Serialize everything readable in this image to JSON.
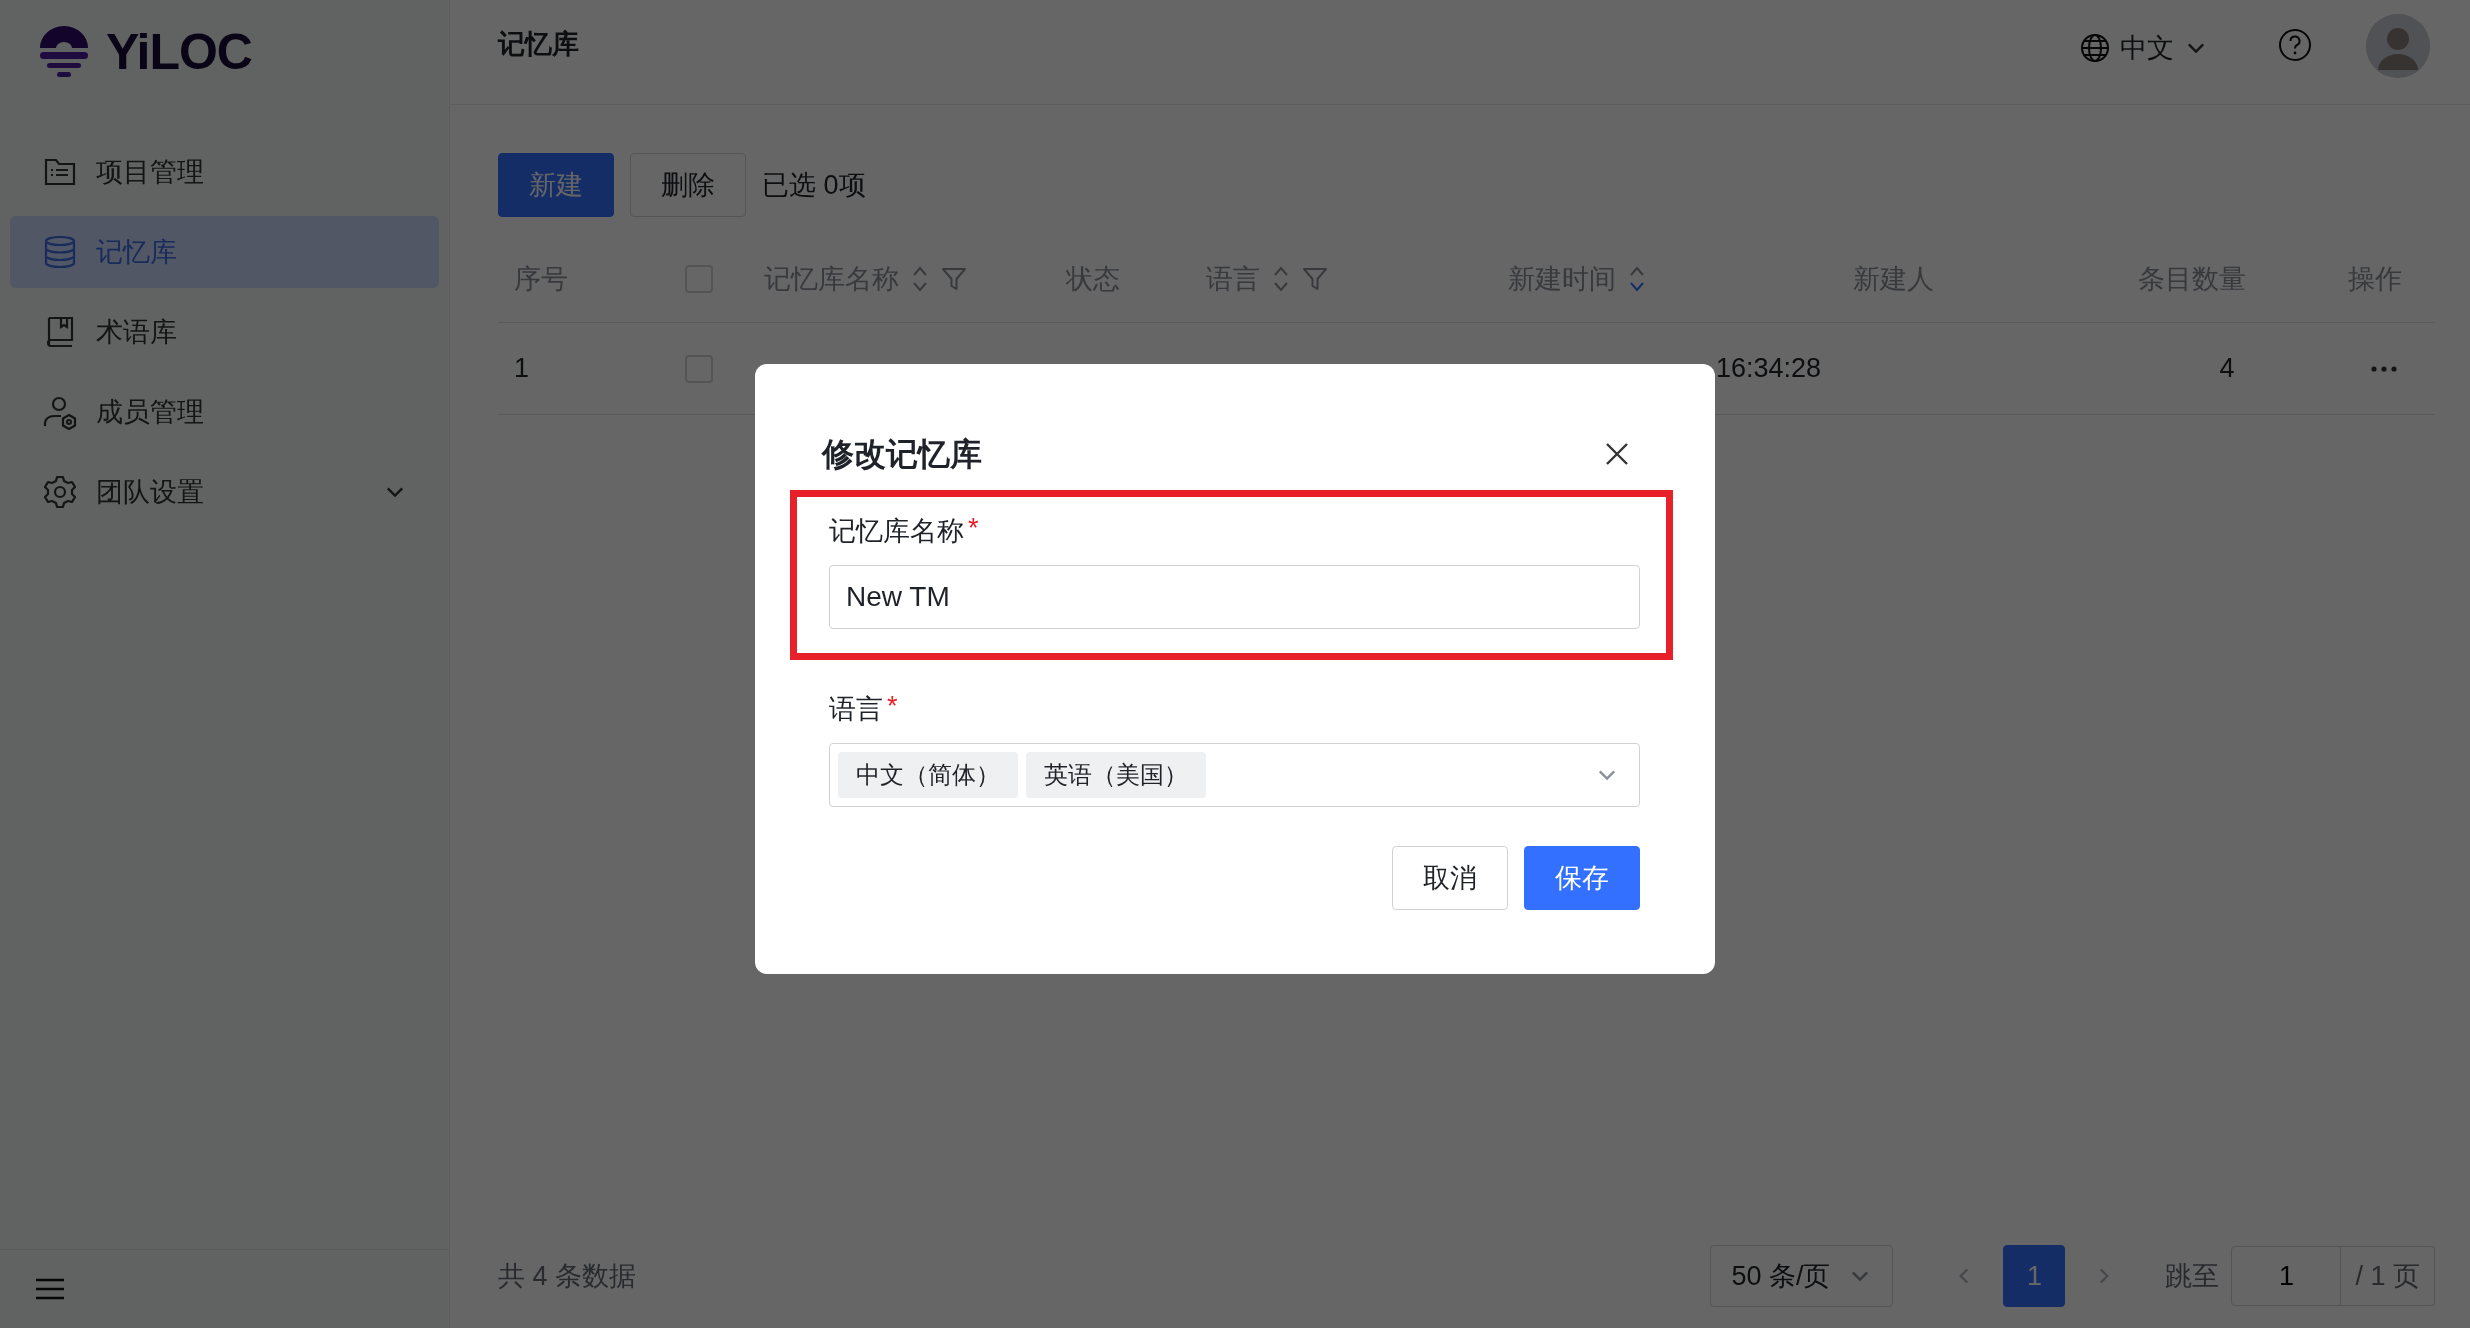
{
  "logo": {
    "text": "YiLOC"
  },
  "sidebar": {
    "items": [
      {
        "label": "项目管理",
        "kind": "link",
        "selected": false
      },
      {
        "label": "记忆库",
        "kind": "link",
        "selected": true
      },
      {
        "label": "术语库",
        "kind": "link",
        "selected": false
      },
      {
        "label": "成员管理",
        "kind": "link",
        "selected": false
      },
      {
        "label": "团队设置",
        "kind": "group",
        "selected": false,
        "expanded": false
      }
    ]
  },
  "header": {
    "title": "记忆库",
    "language": "中文"
  },
  "toolbar": {
    "buttons": [
      {
        "label": "新建",
        "kind": "primary"
      },
      {
        "label": "删除",
        "kind": "default"
      }
    ],
    "selection": "已选 0项"
  },
  "table": {
    "select_all": {
      "checked": false
    },
    "columns": [
      {
        "label": "序号",
        "kind": "text"
      },
      {
        "kind": "checkbox"
      },
      {
        "label": "记忆库名称",
        "kind": "text",
        "sortable": true,
        "filterable": true,
        "sorted_desc": false
      },
      {
        "label": "状态",
        "kind": "text"
      },
      {
        "label": "语言",
        "kind": "text",
        "sortable": true,
        "filterable": true,
        "sorted_desc": false
      },
      {
        "label": "新建时间",
        "kind": "text",
        "sortable": true,
        "filterable": false,
        "sorted_desc": true
      },
      {
        "label": "新建人",
        "kind": "text"
      },
      {
        "label": "条目数量",
        "kind": "text"
      },
      {
        "label": "操作",
        "kind": "text"
      }
    ],
    "rows": [
      {
        "index": "1",
        "checked": false,
        "time": "16:34:28",
        "count": "4"
      }
    ]
  },
  "footer": {
    "total": "共 4 条数据",
    "page_size": "50 条/页",
    "pages": [
      {
        "label": "1",
        "selected": true
      }
    ],
    "jump_label": "跳至",
    "jump_value": "1",
    "page_total": "/ 1 页"
  },
  "modal": {
    "title": "修改记忆库",
    "fields": [
      {
        "kind": "text",
        "label": "记忆库名称",
        "required_mark": "*",
        "value": "New TM",
        "highlighted": true
      },
      {
        "kind": "select",
        "label": "语言",
        "required_mark": "*",
        "tags": [
          "中文（简体）",
          "英语（美国）"
        ],
        "highlighted": false
      }
    ],
    "buttons": [
      {
        "label": "取消",
        "kind": "default"
      },
      {
        "label": "保存",
        "kind": "primary"
      }
    ]
  }
}
